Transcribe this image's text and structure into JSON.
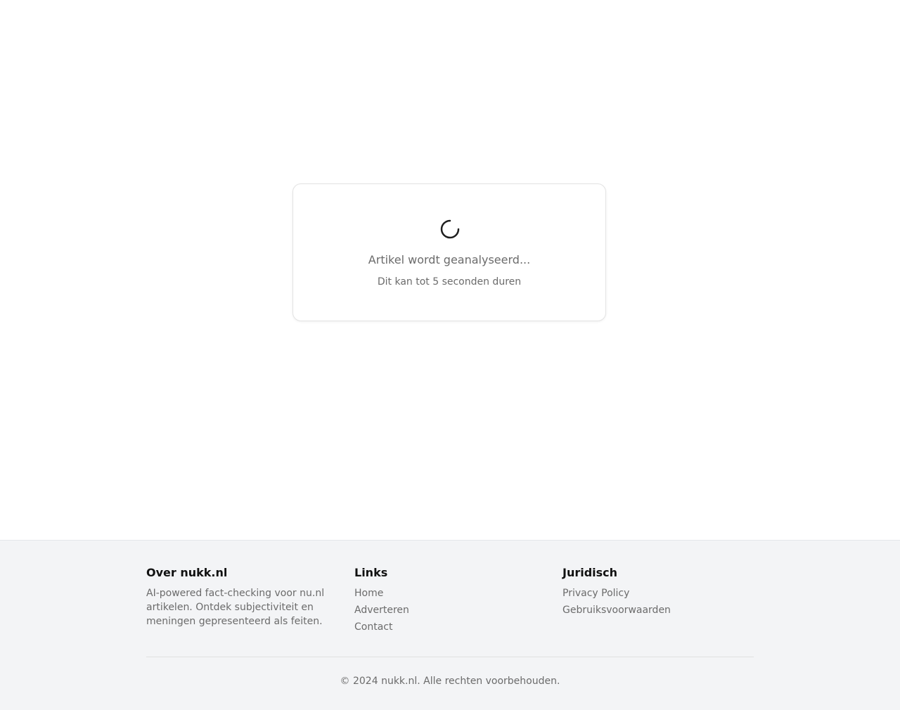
{
  "loading": {
    "title": "Artikel wordt geanalyseerd...",
    "subtitle": "Dit kan tot 5 seconden duren",
    "spinner_icon": "spinner-icon"
  },
  "footer": {
    "about": {
      "heading": "Over nukk.nl",
      "text": "AI-powered fact-checking voor nu.nl artikelen. Ontdek subjectiviteit en meningen gepresenteerd als feiten."
    },
    "links": {
      "heading": "Links",
      "items": [
        "Home",
        "Adverteren",
        "Contact"
      ]
    },
    "legal": {
      "heading": "Juridisch",
      "items": [
        "Privacy Policy",
        "Gebruiksvoorwaarden"
      ]
    },
    "copyright": "© 2024 nukk.nl. Alle rechten voorbehouden."
  },
  "colors": {
    "background": "#ffffff",
    "footer_background": "#f3f4f6",
    "muted_text": "#6b6b6b",
    "heading_text": "#111111",
    "spinner": "#1f1f1f"
  }
}
